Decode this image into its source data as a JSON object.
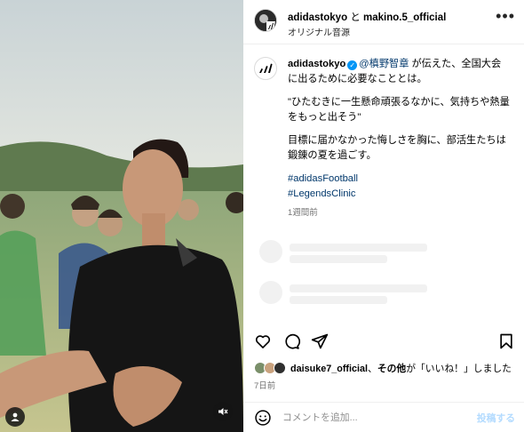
{
  "header": {
    "account_primary": "adidastokyo",
    "conjunction": "と",
    "account_secondary": "makino.5_official",
    "audio_label": "オリジナル音源",
    "more_label": "•••"
  },
  "caption": {
    "username": "adidastokyo",
    "verified_mark": "✓",
    "mention": "@槙野智章",
    "line1_rest": " が伝えた、全国大会に出るために必要なこととは。",
    "quote": "\"ひたむきに一生懸命頑張るなかに、気持ちや熱量をもっと出そう\"",
    "paragraph": "目標に届かなかった悔しさを胸に、部活生たちは鍛錬の夏を過ごす。",
    "hashtag1": "#adidasFootball",
    "hashtag2": "#LegendsClinic",
    "time_ago": "1週間前"
  },
  "likes": {
    "user": "daisuke7_official",
    "middle": "、",
    "others": "その他",
    "suffix": "が「いいね！」しました"
  },
  "post_date": "7日前",
  "comment": {
    "placeholder": "コメントを追加...",
    "post_label": "投稿する"
  },
  "icons": {
    "like": "heart-icon",
    "comment": "comment-icon",
    "share": "send-icon",
    "save": "bookmark-icon",
    "emoji": "smiley-icon",
    "mute": "speaker-muted-icon",
    "tagged_users": "user-icon"
  },
  "colors": {
    "link": "#00376b",
    "verified": "#0095f6",
    "post_button_disabled": "#b3dbff",
    "muted_text": "#737373"
  }
}
